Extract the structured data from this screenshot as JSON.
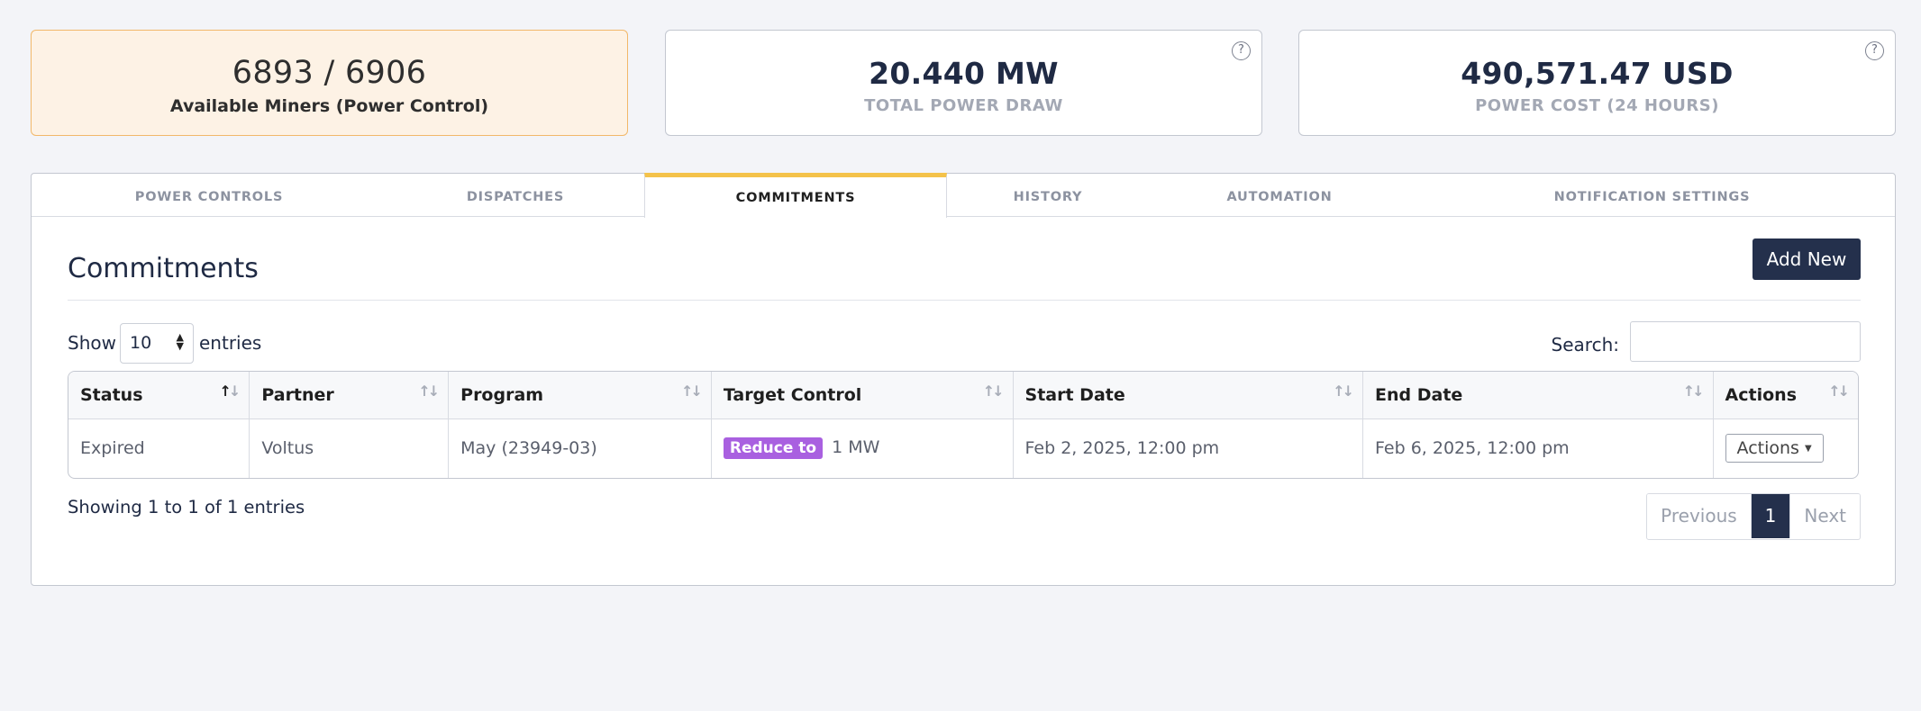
{
  "cards": [
    {
      "value": "6893 / 6906",
      "label": "Available Miners (Power Control)"
    },
    {
      "value": "20.440 MW",
      "label": "TOTAL POWER DRAW"
    },
    {
      "value": "490,571.47 USD",
      "label": "POWER COST (24 HOURS)"
    }
  ],
  "help_glyph": "?",
  "tabs": [
    "POWER CONTROLS",
    "DISPATCHES",
    "COMMITMENTS",
    "HISTORY",
    "AUTOMATION",
    "NOTIFICATION SETTINGS"
  ],
  "active_tab": "COMMITMENTS",
  "page_title": "Commitments",
  "add_button": "Add New",
  "show_label": "Show",
  "page_size": "10",
  "entries_label": "entries",
  "search_label": "Search:",
  "search_value": "",
  "columns": [
    "Status",
    "Partner",
    "Program",
    "Target Control",
    "Start Date",
    "End Date",
    "Actions"
  ],
  "rows": [
    {
      "status": "Expired",
      "partner": "Voltus",
      "program": "May (23949-03)",
      "target_badge": "Reduce to",
      "target_value": "1 MW",
      "start": "Feb 2, 2025, 12:00 pm",
      "end": "Feb 6, 2025, 12:00 pm",
      "actions": "Actions"
    }
  ],
  "info_text": "Showing 1 to 1 of 1 entries",
  "pager": {
    "previous": "Previous",
    "current": "1",
    "next": "Next"
  },
  "colors": {
    "accent": "#f4c24a",
    "primary": "#24304c",
    "badge": "#a960e0",
    "highlight_bg": "#fdf2e5"
  }
}
